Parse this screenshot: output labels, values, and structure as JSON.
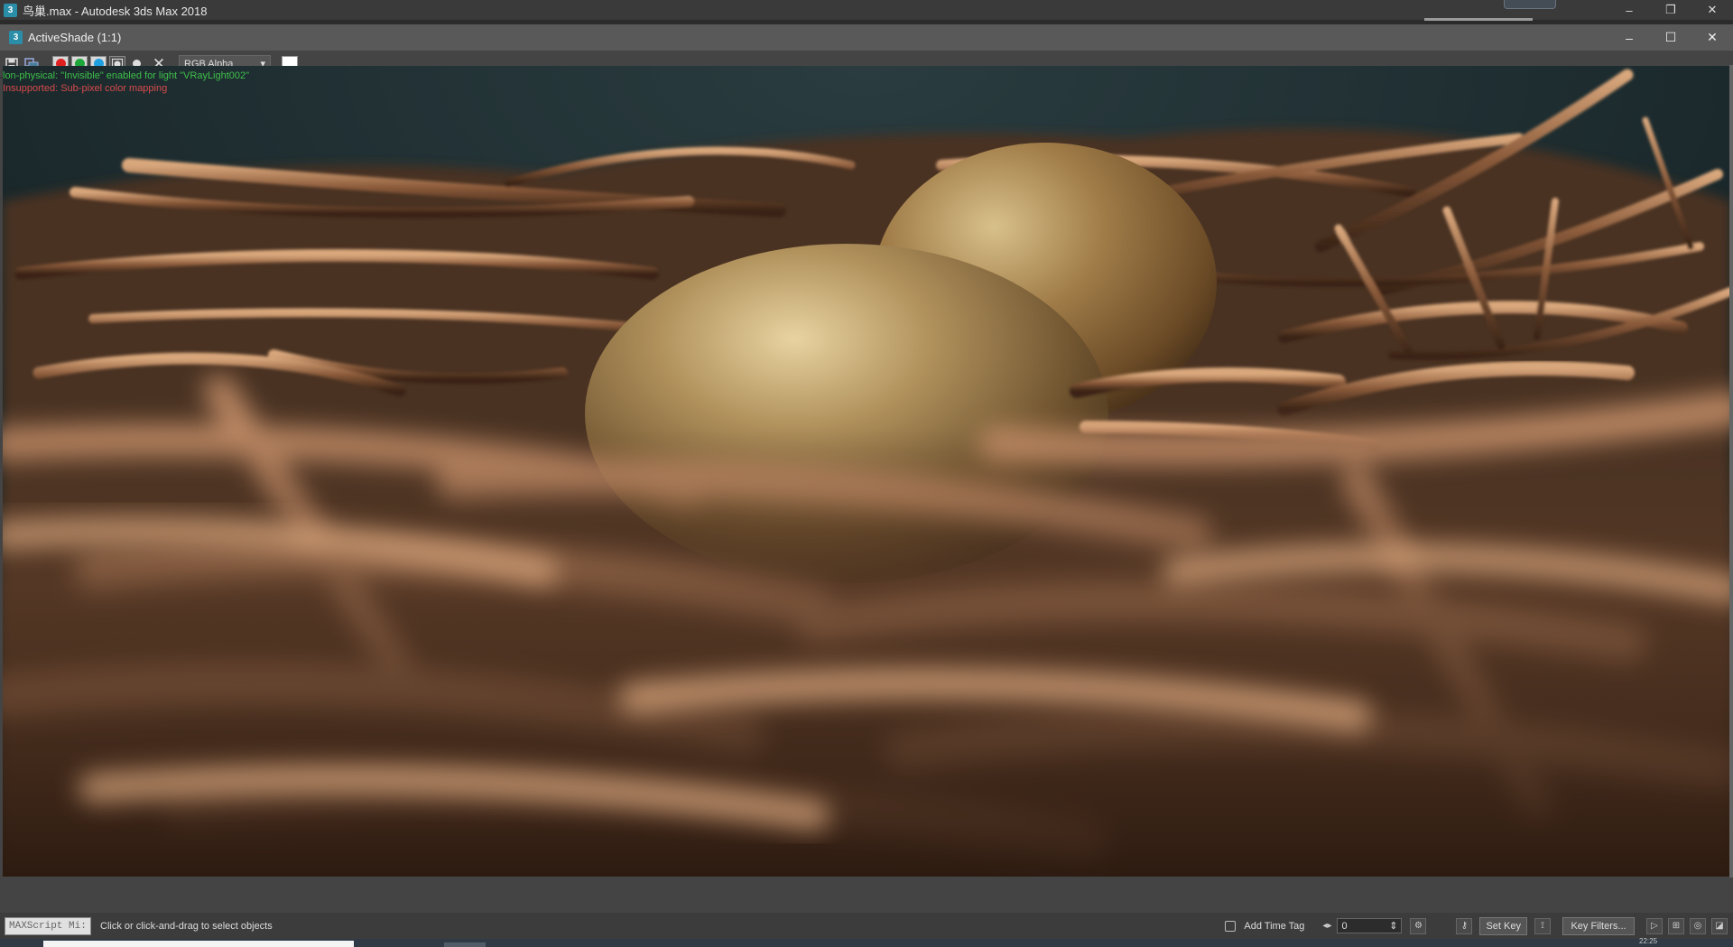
{
  "window": {
    "title": "鸟巢.max - Autodesk 3ds Max 2018",
    "icon_label": "3",
    "controls": [
      "–",
      "❐",
      "✕"
    ]
  },
  "activeshade": {
    "title": "ActiveShade (1:1)",
    "icon_label": "3",
    "controls": [
      "–",
      "☐",
      "✕"
    ]
  },
  "toolbar": {
    "channel_select": "RGB Alpha",
    "channel_colors": {
      "red": "#e02020",
      "green": "#1ea83c",
      "blue": "#1ea0e0"
    },
    "clear_glyph": "✕",
    "dropdown_glyph": "▾"
  },
  "render_messages": {
    "warning": "lon-physical: \"Invisible\" enabled for light \"VRayLight002\"",
    "error": "Insupported: Sub-pixel color mapping"
  },
  "statusbar": {
    "maxscript": "MAXScript Mi:",
    "prompt": "Click or click-and-drag to select objects",
    "add_time_tag": "Add Time Tag",
    "frame_value": "0",
    "set_key": "Set Key",
    "key_filters": "Key Filters..."
  },
  "taskbar": {
    "clock": "22:25"
  }
}
